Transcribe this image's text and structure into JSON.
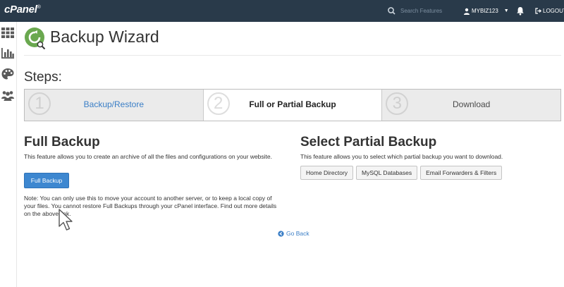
{
  "topbar": {
    "logo": "cPanel",
    "logo_mark": "®",
    "search_placeholder": "Search Features",
    "username": "MYBIZ123",
    "logout_label": "LOGOUT"
  },
  "sidebar": {
    "icons": [
      "grid-icon",
      "stats-icon",
      "palette-icon",
      "users-icon"
    ]
  },
  "page": {
    "title": "Backup Wizard",
    "steps_label": "Steps:"
  },
  "steps": [
    {
      "number": "1",
      "label": "Backup/Restore",
      "state": "link"
    },
    {
      "number": "2",
      "label": "Full or Partial Backup",
      "state": "active"
    },
    {
      "number": "3",
      "label": "Download",
      "state": "pending"
    }
  ],
  "full_backup": {
    "title": "Full Backup",
    "description": "This feature allows you to create an archive of all the files and configurations on your website.",
    "button_label": "Full Backup",
    "note": "Note: You can only use this to move your account to another server, or to keep a local copy of your files. You cannot restore Full Backups through your cPanel interface. Find out more details on the above link."
  },
  "partial_backup": {
    "title": "Select Partial Backup",
    "description": "This feature allows you to select which partial backup you want to download.",
    "buttons": [
      "Home Directory",
      "MySQL Databases",
      "Email Forwarders & Filters"
    ]
  },
  "footer": {
    "go_back_label": "Go Back"
  },
  "colors": {
    "topbar": "#293a4a",
    "primary": "#3d87d0",
    "link": "#3a7ec6",
    "icon_green": "#6aa84f"
  }
}
